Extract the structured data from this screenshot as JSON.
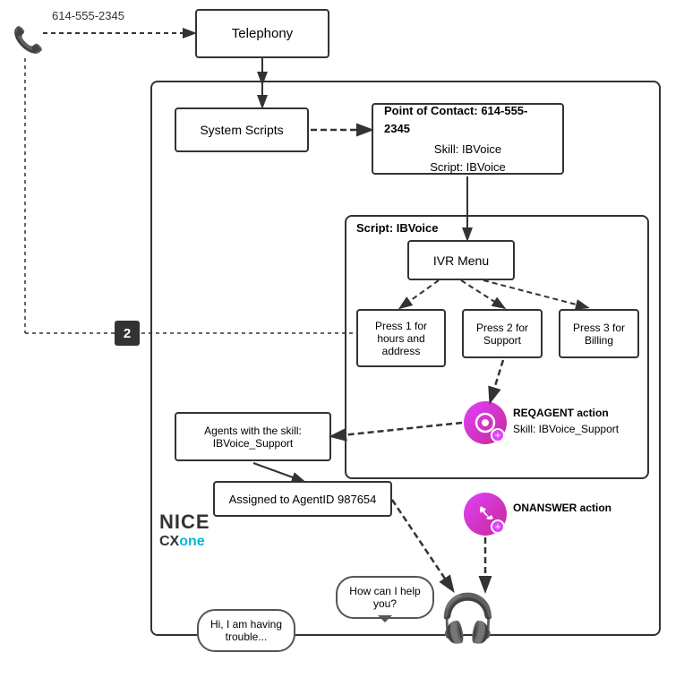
{
  "phone_number": "614-555-2345",
  "telephony_label": "Telephony",
  "system_scripts_label": "System Scripts",
  "poc_label": "Point of Contact: 614-555-2345",
  "poc_skill": "Skill: IBVoice",
  "poc_script": "Script: IBVoice",
  "script_label": "Script: IBVoice",
  "ivr_label": "IVR Menu",
  "press1_label": "Press 1 for hours and address",
  "press2_label": "Press 2 for Support",
  "press3_label": "Press 3 for Billing",
  "badge_number": "2",
  "reqagent_label": "REQAGENT action",
  "reqagent_skill": "Skill: IBVoice_Support",
  "agents_label": "Agents with the skill: IBVoice_Support",
  "assigned_label": "Assigned to AgentID 987654",
  "onanswer_label": "ONANSWER action",
  "bubble_agent": "How can I help you?",
  "bubble_caller": "Hi, I am having trouble...",
  "nice_text": "NICE",
  "cx_text": "CX",
  "one_text": "one"
}
